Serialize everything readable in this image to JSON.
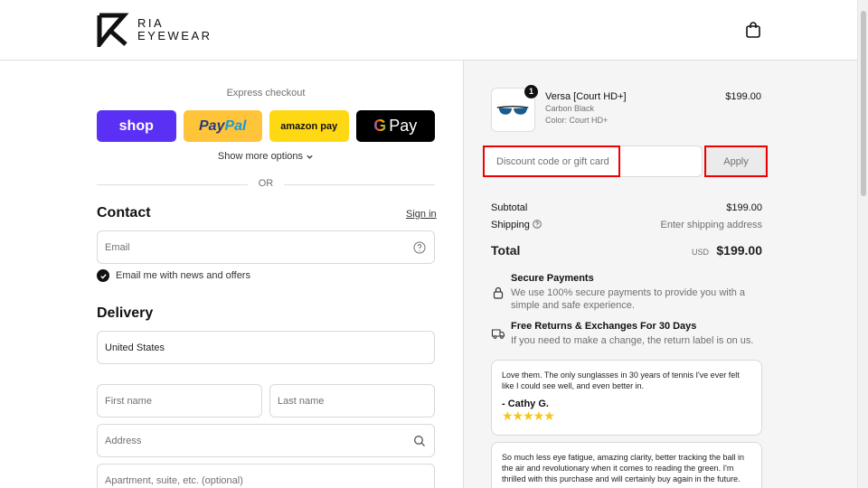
{
  "header": {
    "brand_line1": "RIA",
    "brand_line2": "EYEWEAR",
    "cart_icon": "shopping-bag-icon"
  },
  "express": {
    "title": "Express checkout",
    "buttons": {
      "shop": "shop",
      "paypal_pay": "Pay",
      "paypal_pal": "Pal",
      "amazon": "amazon pay",
      "gpay_g": "G",
      "gpay_text": "Pay"
    },
    "show_more": "Show more options",
    "or": "OR"
  },
  "contact": {
    "title": "Contact",
    "sign_in": "Sign in",
    "email_placeholder": "Email",
    "newsletter_label": "Email me with news and offers",
    "newsletter_checked": true
  },
  "delivery": {
    "title": "Delivery",
    "country": "United States",
    "first_name_placeholder": "First name",
    "last_name_placeholder": "Last name",
    "address_placeholder": "Address",
    "apartment_placeholder": "Apartment, suite, etc. (optional)"
  },
  "summary": {
    "item": {
      "quantity": "1",
      "name": "Versa [Court HD+]",
      "variant": "Carbon Black",
      "color": "Color: Court HD+",
      "price": "$199.00"
    },
    "discount_placeholder": "Discount code or gift card",
    "apply_label": "Apply",
    "subtotal_label": "Subtotal",
    "subtotal_value": "$199.00",
    "shipping_label": "Shipping",
    "shipping_value": "Enter shipping address",
    "total_label": "Total",
    "total_currency": "USD",
    "total_value": "$199.00",
    "features": [
      {
        "title": "Secure Payments",
        "desc": "We use 100% secure payments to provide you with a simple and safe experience.",
        "icon": "lock-icon"
      },
      {
        "title": "Free Returns & Exchanges For 30 Days",
        "desc": "If you need to make a change, the return label is on us.",
        "icon": "truck-icon"
      }
    ],
    "reviews": [
      {
        "text": "Love them. The only sunglasses in 30 years of tennis I've ever felt like I could see well, and even better in.",
        "author": "- Cathy G.",
        "stars": "★★★★★"
      },
      {
        "text": "So much less eye fatigue, amazing clarity, better tracking the ball in the air and revolutionary when it comes to reading the green. I'm thrilled with this purchase and will certainly buy again in the future."
      }
    ]
  }
}
